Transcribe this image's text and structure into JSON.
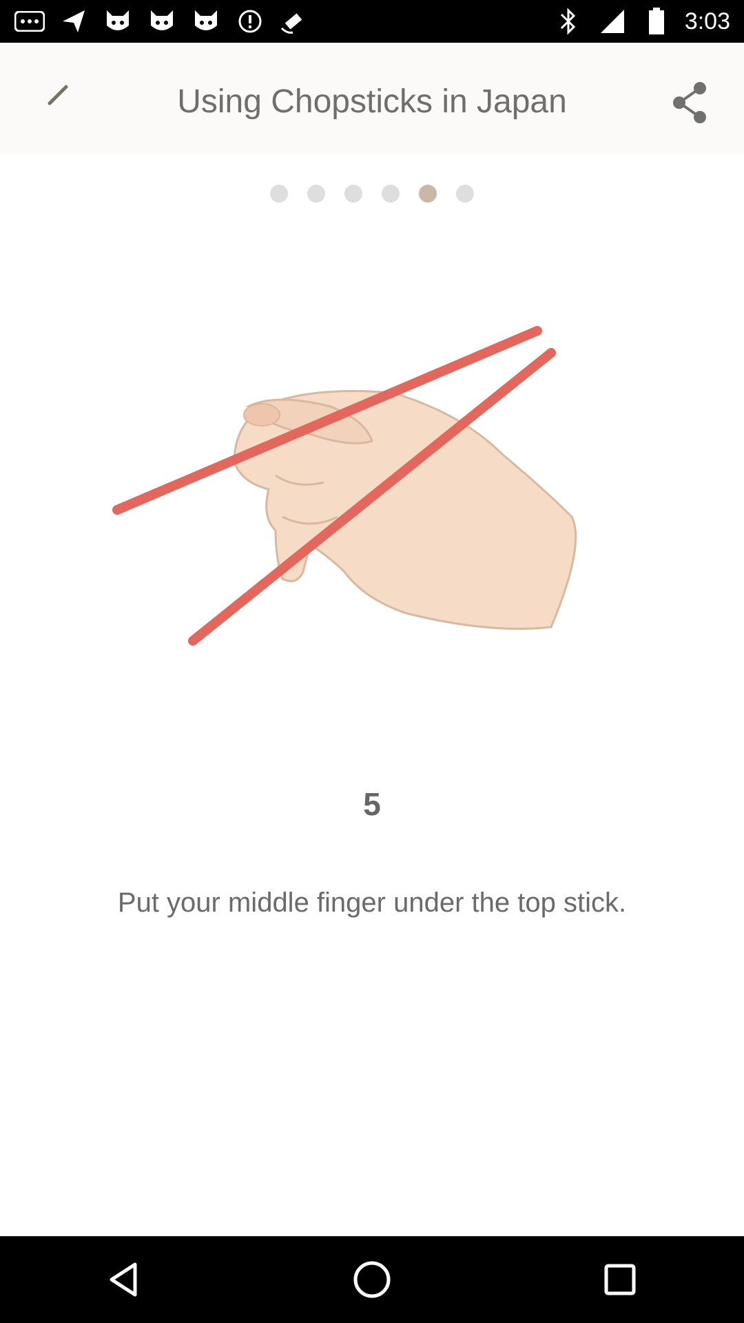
{
  "status_bar": {
    "time": "3:03",
    "icons": [
      "more-icon",
      "send-icon",
      "cat-icon",
      "cat-icon",
      "cat-icon",
      "info-icon",
      "fake-gps-icon",
      "bluetooth-icon",
      "signal-icon",
      "battery-icon"
    ]
  },
  "header": {
    "title": "Using Chopsticks in Japan",
    "back_icon": "back-icon",
    "share_icon": "share-icon"
  },
  "pager": {
    "total": 6,
    "active_index": 4
  },
  "content": {
    "step_number": "5",
    "instruction": "Put your middle finger under the top stick."
  },
  "nav_bar": {
    "icons": [
      "back-triangle-icon",
      "home-circle-icon",
      "recents-square-icon"
    ]
  },
  "colors": {
    "active_dot": "#cbb7a6",
    "inactive_dot": "#dedede",
    "chopstick": "#e3675c",
    "skin": "#f6dcc6"
  }
}
